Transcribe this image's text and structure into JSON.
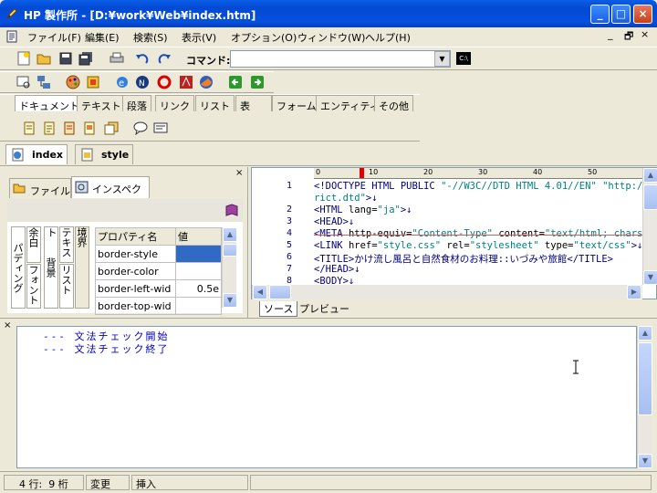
{
  "window": {
    "title": "HP 製作所 - [D:¥work¥Web¥index.htm]",
    "minimize": "_",
    "maximize": "□",
    "close": "×"
  },
  "menu": [
    "ファイル(F)",
    "編集(E)",
    "検索(S)",
    "表示(V)",
    "オプション(O)",
    "ウィンドウ(W)",
    "ヘルプ(H)"
  ],
  "mdi_controls": [
    "_",
    "🗗",
    "×"
  ],
  "toolbar": {
    "command_label": "コマンド:",
    "command_value": "",
    "cmd_icon": "C:\\"
  },
  "tag_tabs": [
    "ドキュメント",
    "テキスト",
    "段落",
    "リンク",
    "リスト",
    "表",
    "フォーム",
    "エンティティ",
    "その他"
  ],
  "doc_tabs": [
    "index",
    "style"
  ],
  "left_panel": {
    "tabs": [
      "ファイル",
      "インスペクタ"
    ],
    "vtabs": [
      "パディング",
      "余白",
      "フォント",
      "背景",
      "リスト",
      "テキスト",
      "境界"
    ],
    "grid_headers": [
      "プロパティ名",
      "値"
    ],
    "rows": [
      {
        "name": "border-style",
        "value": ""
      },
      {
        "name": "border-color",
        "value": ""
      },
      {
        "name": "border-left-wid",
        "value": "0.5e"
      },
      {
        "name": "border-top-wid",
        "value": ""
      }
    ]
  },
  "editor": {
    "ruler": [
      "0",
      "10",
      "20",
      "30",
      "40",
      "50"
    ],
    "line_numbers": [
      "1",
      "",
      "2",
      "3",
      "4",
      "5",
      "6",
      "7",
      "8"
    ],
    "lines": [
      [
        [
          "t",
          "<!DOCTYPE HTML PUBLIC "
        ],
        [
          "v",
          "\"-//W3C//DTD HTML 4.01//EN\""
        ],
        [
          "t",
          " "
        ],
        [
          "v",
          "\"http://w"
        ]
      ],
      [
        [
          "v",
          "rict.dtd\""
        ],
        [
          "t",
          ">↓"
        ]
      ],
      [
        [
          "t",
          "<HTML "
        ],
        [
          "a",
          "lang="
        ],
        [
          "v",
          "\"ja\""
        ],
        [
          "t",
          ">↓"
        ]
      ],
      [
        [
          "t",
          "<HEAD>↓"
        ]
      ],
      [
        [
          "t",
          "<META "
        ],
        [
          "a",
          "http-equiv="
        ],
        [
          "v",
          "\"Content-Type\""
        ],
        [
          "a",
          " content="
        ],
        [
          "v",
          "\"text/html; charset"
        ]
      ],
      [
        [
          "t",
          "<LINK "
        ],
        [
          "a",
          "href="
        ],
        [
          "v",
          "\"style.css\""
        ],
        [
          "a",
          " rel="
        ],
        [
          "v",
          "\"stylesheet\""
        ],
        [
          "a",
          " type="
        ],
        [
          "v",
          "\"text/css\""
        ],
        [
          "t",
          ">↓"
        ]
      ],
      [
        [
          "t",
          "<TITLE>かけ流し風呂と自然食材のお料理::いづみや旅館</TITLE>"
        ]
      ],
      [
        [
          "t",
          "</HEAD>↓"
        ]
      ],
      [
        [
          "t",
          "<BODY>↓"
        ]
      ]
    ],
    "bottom_tabs": [
      "ソース",
      "プレビュー"
    ]
  },
  "output": {
    "lines": [
      "--- 文法チェック開始",
      "--- 文法チェック終了"
    ]
  },
  "status": {
    "position": "4 行:  9 桁",
    "modified": "変更",
    "mode": "挿入"
  }
}
